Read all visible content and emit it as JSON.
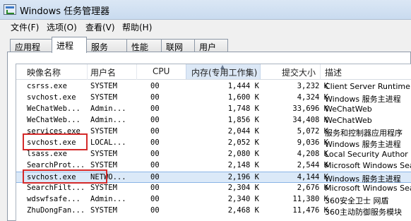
{
  "window": {
    "title": "Windows 任务管理器",
    "icon": "task-manager-icon"
  },
  "menu": [
    {
      "id": "file",
      "label": "文件(F)"
    },
    {
      "id": "options",
      "label": "选项(O)"
    },
    {
      "id": "view",
      "label": "查看(V)"
    },
    {
      "id": "help",
      "label": "帮助(H)"
    }
  ],
  "tabs": [
    {
      "id": "apps",
      "label": "应用程序"
    },
    {
      "id": "processes",
      "label": "进程",
      "active": true
    },
    {
      "id": "services",
      "label": "服务"
    },
    {
      "id": "performance",
      "label": "性能"
    },
    {
      "id": "network",
      "label": "联网"
    },
    {
      "id": "users",
      "label": "用户"
    }
  ],
  "columns": {
    "name": "映像名称",
    "user": "用户名",
    "cpu": "CPU",
    "memory": "内存(专用工作集)",
    "commit": "提交大小",
    "description": "描述"
  },
  "sorted_column": "memory",
  "rows": [
    {
      "name": "csrss.exe",
      "user": "SYSTEM",
      "cpu": "00",
      "memory": "1,444 K",
      "commit": "3,232 K",
      "description": "Client Server Runtime"
    },
    {
      "name": "svchost.exe",
      "user": "SYSTEM",
      "cpu": "00",
      "memory": "1,600 K",
      "commit": "4,324 K",
      "description": "Windows 服务主进程"
    },
    {
      "name": "WeChatWeb...",
      "user": "Admin...",
      "cpu": "00",
      "memory": "1,748 K",
      "commit": "33,696 K",
      "description": "WeChatWeb"
    },
    {
      "name": "WeChatWeb...",
      "user": "Admin...",
      "cpu": "00",
      "memory": "1,856 K",
      "commit": "34,408 K",
      "description": "WeChatWeb"
    },
    {
      "name": "services.exe",
      "user": "SYSTEM",
      "cpu": "00",
      "memory": "2,044 K",
      "commit": "5,072 K",
      "description": "服务和控制器应用程序"
    },
    {
      "name": "svchost.exe",
      "user": "LOCAL...",
      "cpu": "00",
      "memory": "2,052 K",
      "commit": "9,036 K",
      "description": "Windows 服务主进程"
    },
    {
      "name": "lsass.exe",
      "user": "SYSTEM",
      "cpu": "00",
      "memory": "2,080 K",
      "commit": "4,208 K",
      "description": "Local Security Author"
    },
    {
      "name": "SearchProt...",
      "user": "SYSTEM",
      "cpu": "00",
      "memory": "2,148 K",
      "commit": "2,544 K",
      "description": "Microsoft Windows Sea"
    },
    {
      "name": "svchost.exe",
      "user": "NETWO...",
      "cpu": "00",
      "memory": "2,196 K",
      "commit": "4,144 K",
      "description": "Windows 服务主进程",
      "selected": true
    },
    {
      "name": "SearchFilt...",
      "user": "SYSTEM",
      "cpu": "00",
      "memory": "2,304 K",
      "commit": "2,676 K",
      "description": "Microsoft Windows Sea"
    },
    {
      "name": "wdswfsafe...",
      "user": "Admin...",
      "cpu": "00",
      "memory": "2,340 K",
      "commit": "11,380 K",
      "description": "360安全卫士 网盾"
    },
    {
      "name": "ZhuDongFan...",
      "user": "SYSTEM",
      "cpu": "00",
      "memory": "2,468 K",
      "commit": "11,476 K",
      "description": "360主动防御服务模块"
    }
  ],
  "annotations": {
    "color": "#d42a2a",
    "highlighted_rows": [
      5,
      8
    ]
  }
}
